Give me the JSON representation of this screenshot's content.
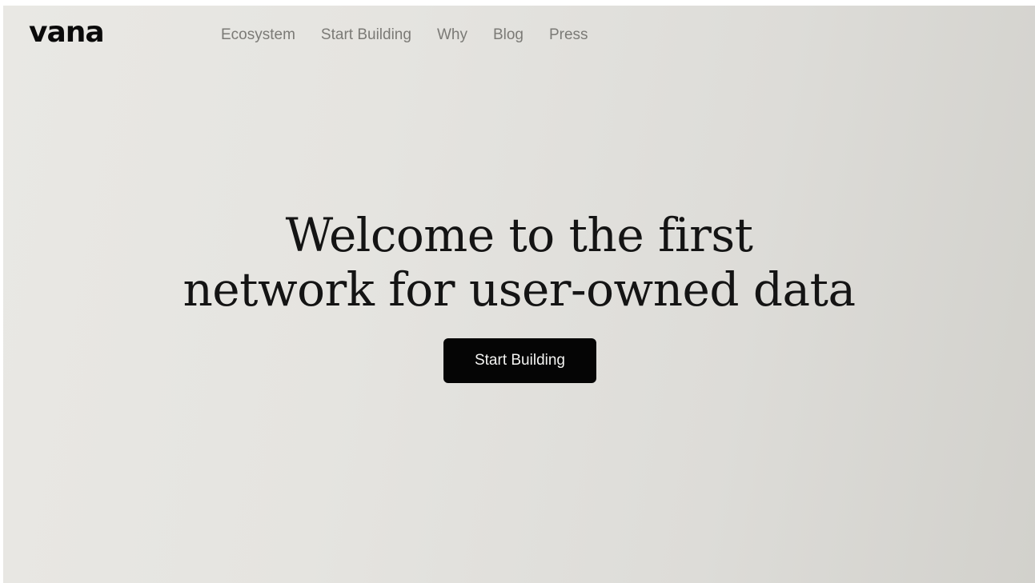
{
  "brand": {
    "logo_text": "vana"
  },
  "nav": {
    "items": [
      {
        "label": "Ecosystem"
      },
      {
        "label": "Start Building"
      },
      {
        "label": "Why"
      },
      {
        "label": "Blog"
      },
      {
        "label": "Press"
      }
    ]
  },
  "hero": {
    "title_line1": "Welcome to the first",
    "title_line2": "network for user-owned data",
    "cta_label": "Start Building"
  },
  "colors": {
    "background": "#e5e4e0",
    "nav_text": "#7b7a76",
    "title_text": "#141414",
    "cta_background": "#050505",
    "cta_text": "#f4f4f2"
  }
}
